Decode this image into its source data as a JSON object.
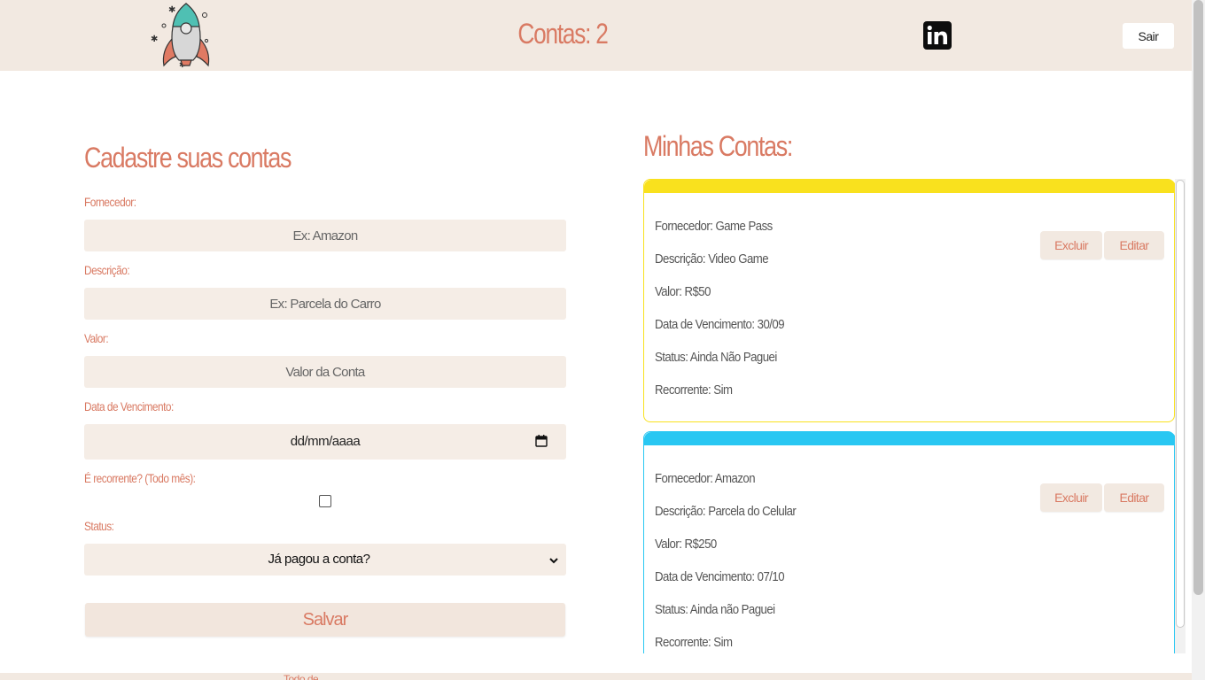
{
  "header": {
    "logo_icon": "rocket-icon",
    "count_label": "Contas: 2",
    "linkedin_icon": "linkedin-icon",
    "logout_label": "Sair"
  },
  "form": {
    "title": "Cadastre suas contas",
    "fornecedor_label": "Fornecedor:",
    "fornecedor_placeholder": "Ex: Amazon",
    "descricao_label": "Descrição:",
    "descricao_placeholder": "Ex: Parcela do Carro",
    "valor_label": "Valor:",
    "valor_placeholder": "Valor da Conta",
    "data_label": "Data de Vencimento:",
    "data_placeholder": "dd/mm/aaaa",
    "recorrente_label": "É recorrente? (Todo mês):",
    "status_label": "Status:",
    "status_selected": "Já pagou a conta?",
    "save_label": "Salvar",
    "footer_text": "Todo de"
  },
  "list": {
    "title": "Minhas Contas:",
    "cards": [
      {
        "accent": "#f9e11e",
        "fornecedor": "Fornecedor: Game Pass",
        "descricao": "Descrição: Video Game",
        "valor": "Valor: R$50",
        "vencimento": "Data de Vencimento: 30/09",
        "status": "Status: Ainda Não Paguei",
        "recorrente": "Recorrente: Sim",
        "delete_label": "Excluir",
        "edit_label": "Editar"
      },
      {
        "accent": "#29c7f2",
        "fornecedor": "Fornecedor: Amazon",
        "descricao": "Descrição: Parcela do Celular",
        "valor": "Valor: R$250",
        "vencimento": "Data de Vencimento: 07/10",
        "status": "Status: Ainda não Paguei",
        "recorrente": "Recorrente: Sim",
        "delete_label": "Excluir",
        "edit_label": "Editar"
      }
    ]
  },
  "colors": {
    "accent": "#d97a63",
    "header_bg": "#f2e9e1",
    "field_bg": "#f5ede6"
  }
}
